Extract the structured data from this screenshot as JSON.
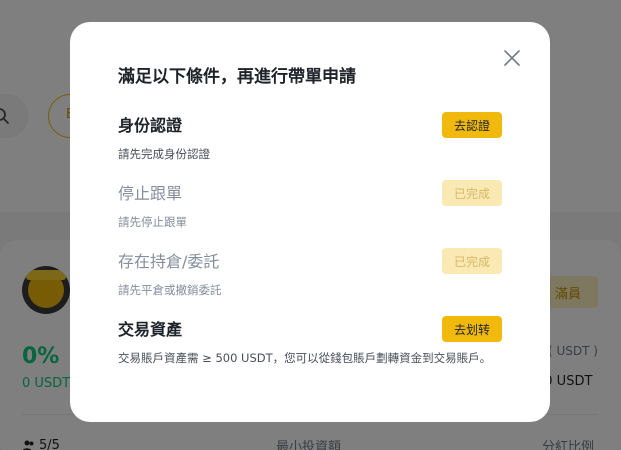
{
  "background": {
    "filter_pill_label": "B",
    "full_button_label": "滿員",
    "roi": "0%",
    "pnl": "0 USDT",
    "aum_label": "( USDT )",
    "aum_value": "00 USDT",
    "members": "5/5",
    "min_invest_label": "最小投資額",
    "profit_share_label": "分紅比例",
    "accent_color": "#f0b90b",
    "positive_color": "#0ecb81"
  },
  "modal": {
    "title": "滿足以下條件，再進行帶單申請",
    "close_icon": "close-icon",
    "requirements": [
      {
        "name": "身份認證",
        "description": "請先完成身份認證",
        "button_label": "去認證",
        "status": "pending"
      },
      {
        "name": "停止跟單",
        "description": "請先停止跟單",
        "button_label": "已完成",
        "status": "done"
      },
      {
        "name": "存在持倉/委託",
        "description": "請先平倉或撤銷委託",
        "button_label": "已完成",
        "status": "done"
      },
      {
        "name": "交易資產",
        "description": "交易賬戶資產需 ≥ 500 USDT，您可以從錢包賬戶劃轉資金到交易賬戶。",
        "button_label": "去划转",
        "status": "pending"
      }
    ]
  }
}
